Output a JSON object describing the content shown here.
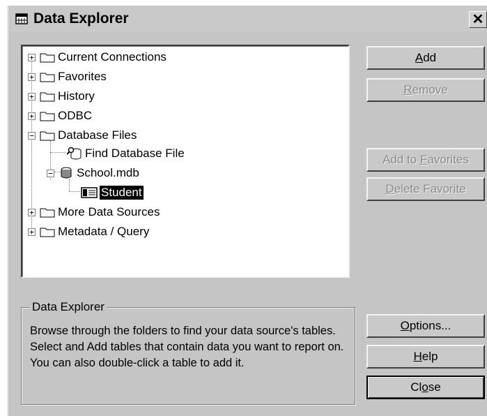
{
  "window": {
    "title": "Data Explorer",
    "close_glyph": "✕"
  },
  "tree": {
    "nodes": [
      {
        "label": "Current Connections",
        "expander": "+"
      },
      {
        "label": "Favorites",
        "expander": "+"
      },
      {
        "label": "History",
        "expander": "+"
      },
      {
        "label": "ODBC",
        "expander": "+"
      },
      {
        "label": "Database Files",
        "expander": "−"
      },
      {
        "label": "Find Database File"
      },
      {
        "label": "School.mdb",
        "expander": "−"
      },
      {
        "label": "Student",
        "selected": true
      },
      {
        "label": "More Data Sources",
        "expander": "+"
      },
      {
        "label": "Metadata / Query",
        "expander": "+"
      }
    ]
  },
  "buttons": {
    "add": {
      "pre": "",
      "key": "A",
      "post": "dd"
    },
    "remove": {
      "pre": "",
      "key": "R",
      "post": "emove"
    },
    "add_favorites": {
      "pre": "Add to ",
      "key": "F",
      "post": "avorites"
    },
    "delete_favorite": {
      "pre": "",
      "key": "D",
      "post": "elete Favorite"
    },
    "options": {
      "pre": "",
      "key": "O",
      "post": "ptions..."
    },
    "help": {
      "pre": "",
      "key": "H",
      "post": "elp"
    },
    "close": {
      "pre": "Cl",
      "key": "o",
      "post": "se"
    }
  },
  "info": {
    "label": "Data Explorer",
    "text": "Browse through the folders to find your data source's tables.  Select and Add tables that contain data you want to report on.  You can also double-click a table to add it."
  }
}
